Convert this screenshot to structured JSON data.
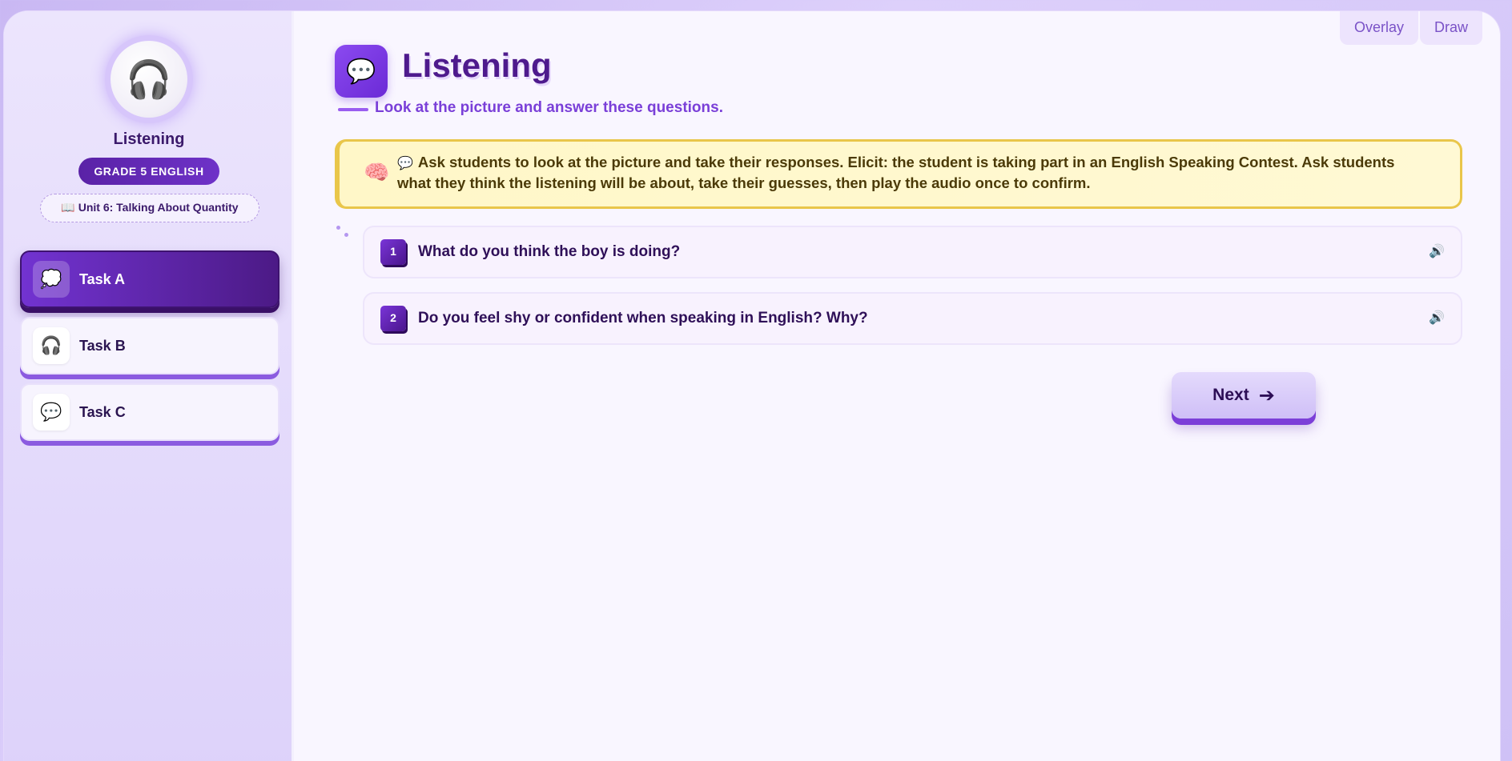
{
  "top_tools": {
    "overlay_label": "Overlay",
    "draw_label": "Draw"
  },
  "sidebar": {
    "title": "Listening",
    "grade_badge": "GRADE 5 ENGLISH",
    "unit_label": "📖 Unit 6: Talking About Quantity",
    "logo_icon": "headphones-icon",
    "tasks": [
      {
        "label": "Task A",
        "icon": "💭",
        "active": true
      },
      {
        "label": "Task B",
        "icon": "🎧",
        "active": false
      },
      {
        "label": "Task C",
        "icon": "💬",
        "active": false
      }
    ]
  },
  "main": {
    "title": "Listening",
    "header_icon": "💬",
    "subtitle": "Look at the picture and answer these questions.",
    "teacher_note": {
      "brain_icon": "🧠",
      "bubble_icon": "💬",
      "text": "Ask students to look at the picture and take their responses. Elicit: the student is taking part in an English Speaking Contest. Ask students what they think the listening will be about, take their guesses, then play the audio once to confirm."
    },
    "questions": [
      {
        "number": "1",
        "text": "What do you think the boy is doing?"
      },
      {
        "number": "2",
        "text": "Do you feel shy or confident when speaking in English? Why?"
      }
    ],
    "next_label": "Next",
    "next_arrow": "➔"
  },
  "colors": {
    "accent": "#6b2ad6",
    "title": "#4e1a8d",
    "note_bg": "#fff7c8",
    "note_border": "#e9c64a"
  }
}
